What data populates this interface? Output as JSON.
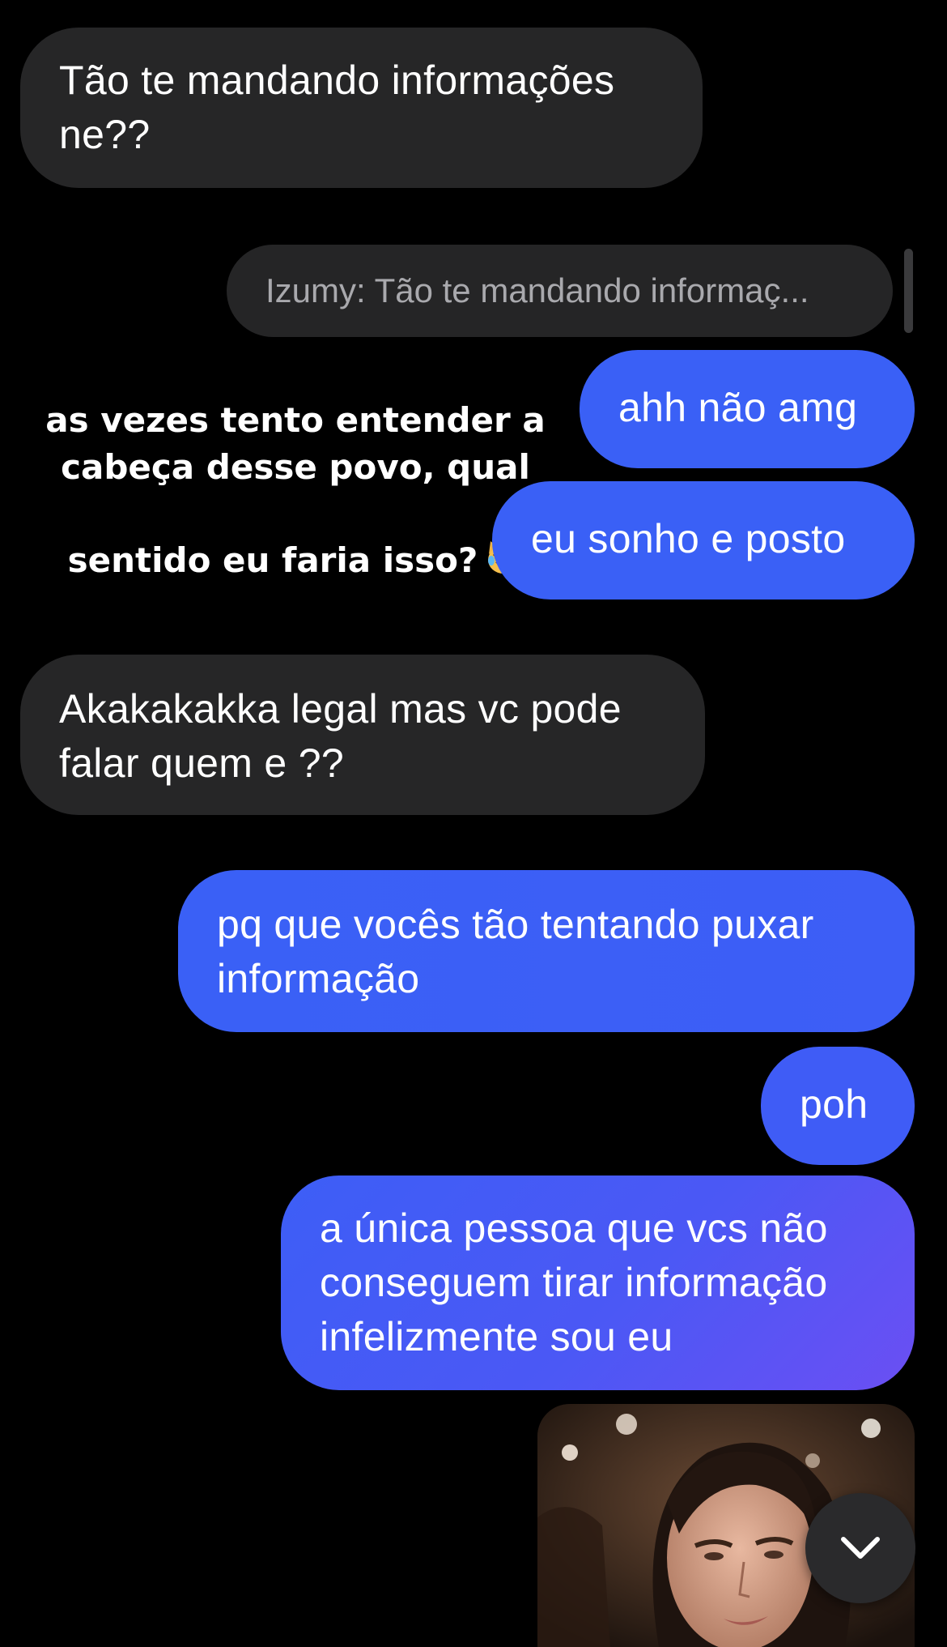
{
  "colors": {
    "background": "#000000",
    "incoming_bubble": "#262627",
    "outgoing_blue": "#3a64f6",
    "outgoing_purple": "#6b4ff3"
  },
  "messages": {
    "m1": "Tão te mandando informações\nne??",
    "reply_preview": "Izumy: Tão te mandando informaç...",
    "m2": "ahh não amg",
    "m3": "eu sonho e posto",
    "m4": "Akakakakka legal mas vc pode\nfalar quem e ??",
    "m5": "pq que vocês tão tentando puxar\ninformação",
    "m6": "poh",
    "m7": "a única pessoa que vcs não\nconseguem tirar informação\ninfelizmente sou eu"
  },
  "overlay": {
    "caption": "as vezes tento entender a\ncabeça desse povo, qual\nsentido eu faria isso?",
    "emoji": "crying-laughing-cat-emoji"
  },
  "controls": {
    "scroll_down_icon": "chevron-down-icon"
  }
}
